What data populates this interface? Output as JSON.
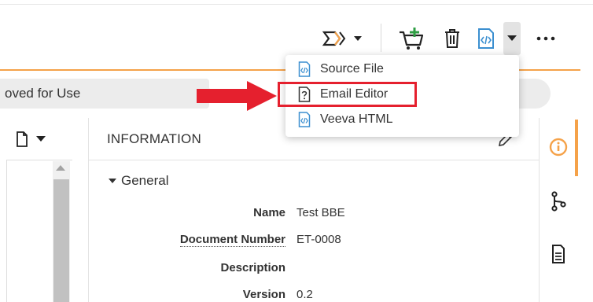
{
  "status": {
    "label": "oved for Use"
  },
  "toolbar": {
    "icons": [
      "workflow-icon",
      "add-to-cart-icon",
      "trash-icon",
      "code-file-icon",
      "caret-down-icon",
      "more-icon"
    ]
  },
  "dropdown": {
    "items": [
      {
        "label": "Source File",
        "icon": "code-file-icon"
      },
      {
        "label": "Email Editor",
        "icon": "unknown-file-icon"
      },
      {
        "label": "Veeva HTML",
        "icon": "code-file-icon"
      }
    ]
  },
  "info": {
    "title": "INFORMATION",
    "section": "General",
    "fields": [
      {
        "label": "Name",
        "value": "Test BBE"
      },
      {
        "label": "Document Number",
        "value": "ET-0008"
      },
      {
        "label": "Description",
        "value": ""
      },
      {
        "label": "Version",
        "value": "0.2"
      }
    ]
  },
  "colors": {
    "accent": "#f5a249",
    "highlight": "#e5202e",
    "icon_blue": "#3b8fd0",
    "cart_green": "#2f9e44"
  }
}
